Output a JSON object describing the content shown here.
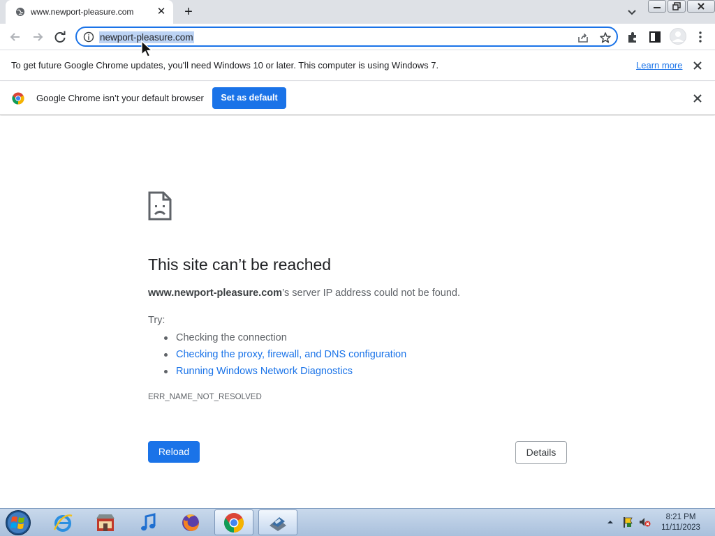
{
  "tab": {
    "title": "www.newport-pleasure.com",
    "close": "✕"
  },
  "new_tab": {
    "label": "+"
  },
  "omnibox": {
    "url": "newport-pleasure.com"
  },
  "update_bar": {
    "message": "To get future Google Chrome updates, you'll need Windows 10 or later. This computer is using Windows 7.",
    "link_label": "Learn more"
  },
  "default_bar": {
    "message": "Google Chrome isn’t your default browser",
    "button_label": "Set as default"
  },
  "error": {
    "title": "This site can’t be reached",
    "host": "www.newport-pleasure.com",
    "description_suffix": "’s server IP address could not be found.",
    "try_label": "Try:",
    "suggestions": [
      {
        "label": "Checking the connection",
        "is_link": false
      },
      {
        "label": "Checking the proxy, firewall, and DNS configuration",
        "is_link": true
      },
      {
        "label": "Running Windows Network Diagnostics",
        "is_link": true
      }
    ],
    "code": "ERR_NAME_NOT_RESOLVED",
    "reload_label": "Reload",
    "details_label": "Details"
  },
  "taskbar": {
    "apps": [
      "internet-explorer-icon",
      "store-icon",
      "itunes-icon",
      "firefox-icon",
      "chrome-icon",
      "app-icon"
    ],
    "active_app": "chrome-icon",
    "clock": {
      "time": "8:21 PM",
      "date": "11/11/2023"
    }
  },
  "colors": {
    "accent": "#1a73e8",
    "text": "#202124",
    "muted": "#5f6368",
    "tabstrip": "#dee1e6"
  }
}
